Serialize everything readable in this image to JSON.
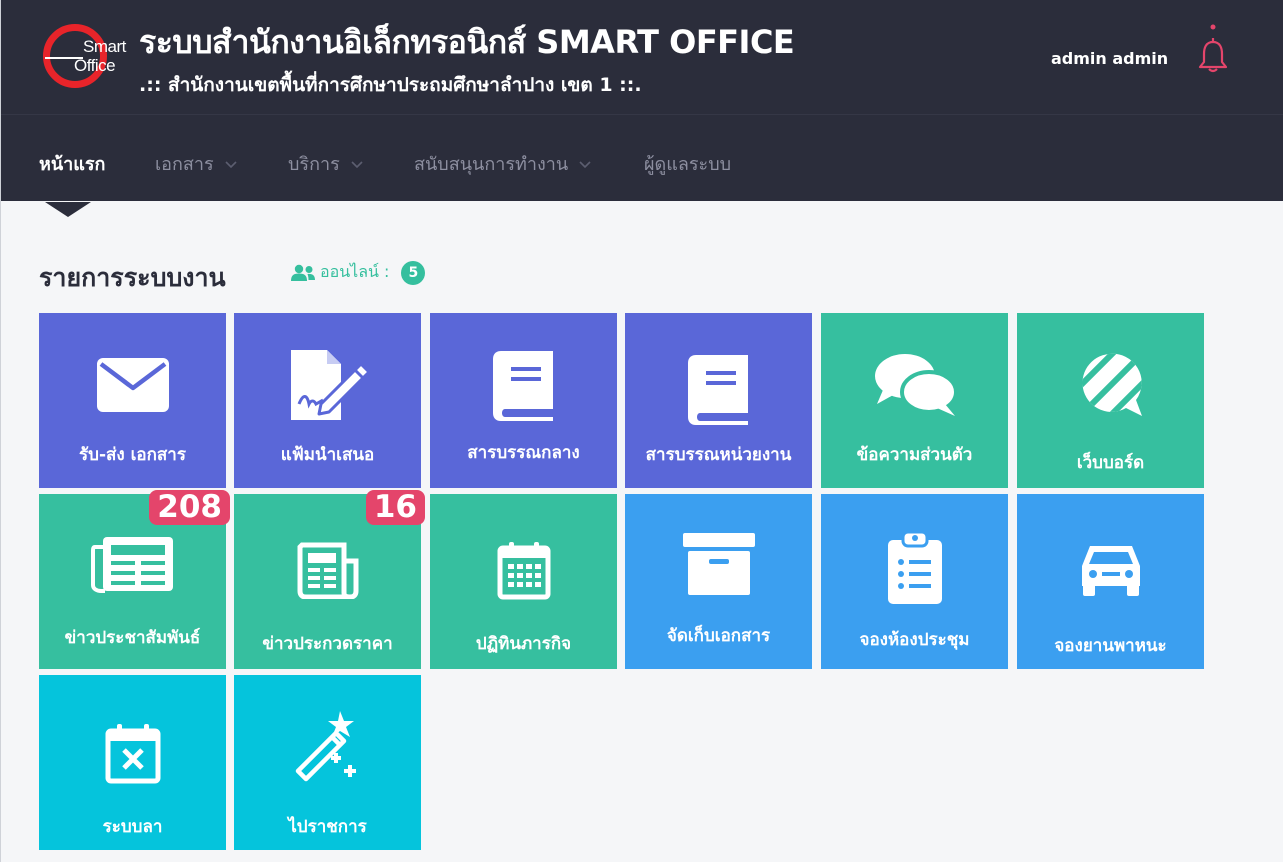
{
  "header": {
    "logo": {
      "line1": "Smart",
      "line2": "Office"
    },
    "title": "ระบบสำนักงานอิเล็กทรอนิกส์ SMART OFFICE",
    "subtitle": ".:: สำนักงานเขตพื้นที่การศึกษาประถมศึกษาลำปาง เขต 1 ::.",
    "user_name": "admin admin",
    "bell_icon": "bell-icon",
    "brand_color": "#e8242a",
    "bell_color": "#e4456b"
  },
  "nav": {
    "items": [
      {
        "label": "หน้าแรก",
        "active": true,
        "dropdown": false
      },
      {
        "label": "เอกสาร",
        "active": false,
        "dropdown": true
      },
      {
        "label": "บริการ",
        "active": false,
        "dropdown": true
      },
      {
        "label": "สนับสนุนการทำงาน",
        "active": false,
        "dropdown": true
      },
      {
        "label": "ผู้ดูแลระบบ",
        "active": false,
        "dropdown": false
      }
    ]
  },
  "main": {
    "section_title": "รายการระบบงาน",
    "online_label": "ออนไลน์ :",
    "online_count": "5",
    "tiles": [
      {
        "label": "รับ-ส่ง เอกสาร",
        "icon": "envelope-icon",
        "color": "#5a67d8"
      },
      {
        "label": "แฟ้มนำเสนอ",
        "icon": "file-signature-icon",
        "color": "#5a67d8"
      },
      {
        "label": "สารบรรณกลาง",
        "icon": "book-icon",
        "color": "#5a67d8"
      },
      {
        "label": "สารบรรณหน่วยงาน",
        "icon": "book-icon",
        "color": "#5a67d8"
      },
      {
        "label": "ข้อความส่วนตัว",
        "icon": "comments-icon",
        "color": "#36bf9f"
      },
      {
        "label": "เว็บบอร์ด",
        "icon": "webboard-icon",
        "color": "#36bf9f"
      },
      {
        "label": "ข่าวประชาสัมพันธ์",
        "icon": "newspaper-icon",
        "color": "#36bf9f",
        "badge": "208"
      },
      {
        "label": "ข่าวประกวดราคา",
        "icon": "newspaper-outline-icon",
        "color": "#36bf9f",
        "badge": "16"
      },
      {
        "label": "ปฏิทินภารกิจ",
        "icon": "calendar-icon",
        "color": "#36bf9f"
      },
      {
        "label": "จัดเก็บเอกสาร",
        "icon": "archive-icon",
        "color": "#3b9ff0"
      },
      {
        "label": "จองห้องประชุม",
        "icon": "clipboard-list-icon",
        "color": "#3b9ff0"
      },
      {
        "label": "จองยานพาหนะ",
        "icon": "car-icon",
        "color": "#3b9ff0"
      },
      {
        "label": "ระบบลา",
        "icon": "calendar-x-icon",
        "color": "#05c4dc"
      },
      {
        "label": "ไปราชการ",
        "icon": "magic-wand-icon",
        "color": "#05c4dc"
      }
    ]
  }
}
